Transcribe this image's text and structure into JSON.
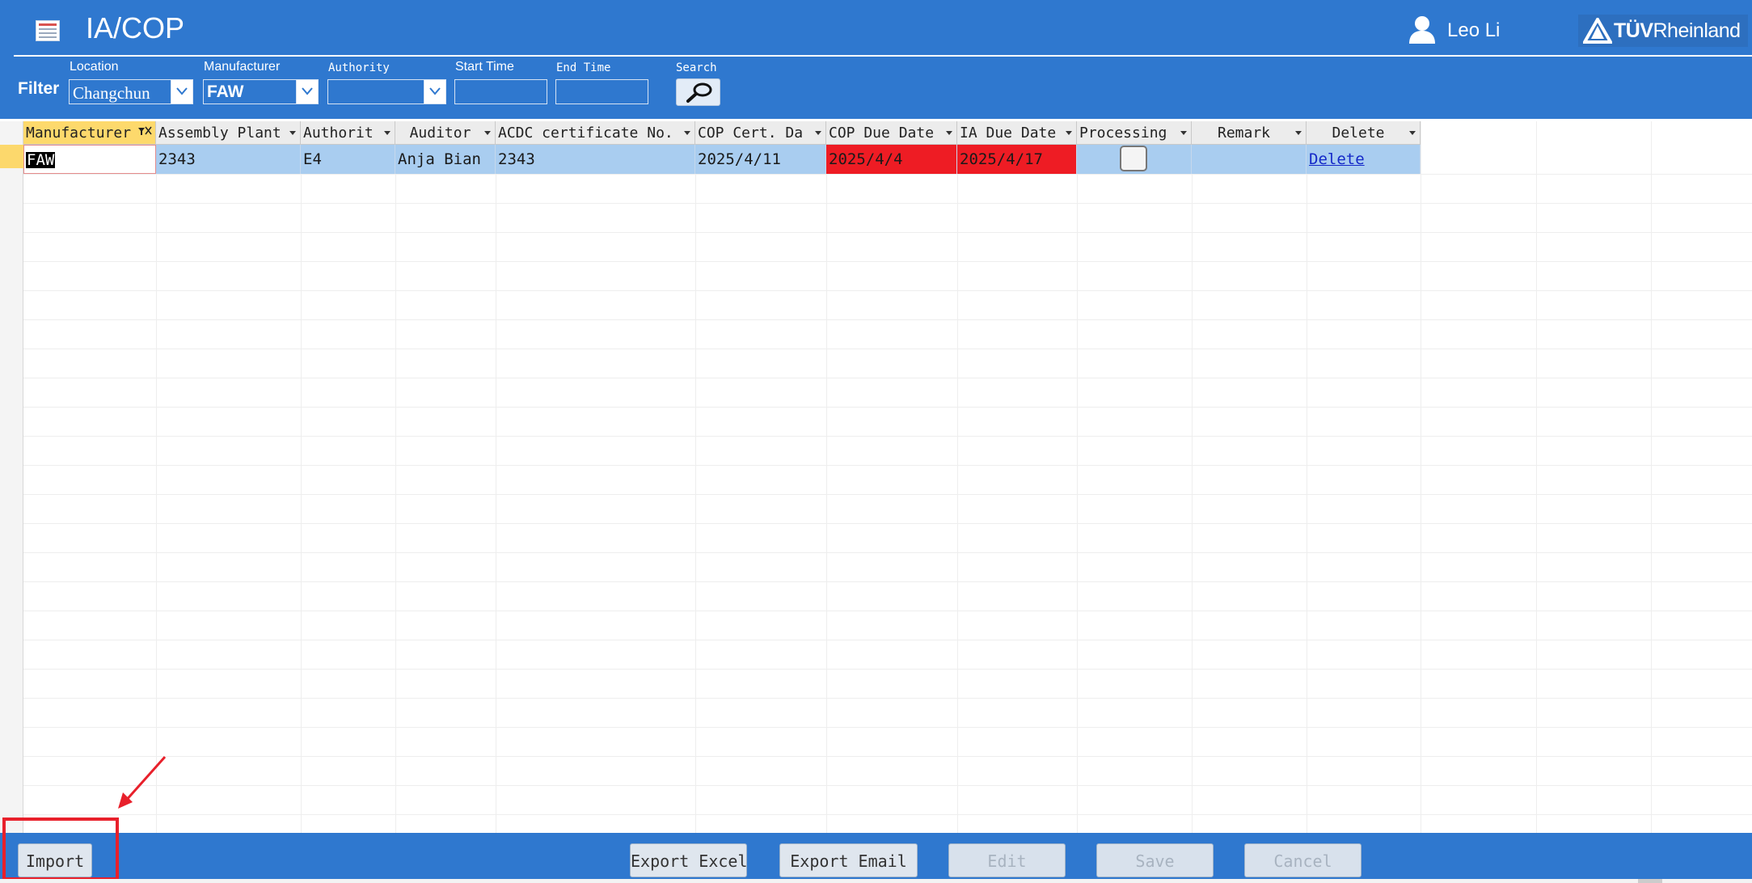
{
  "header": {
    "title": "IA/COP",
    "user_name": "Leo Li",
    "brand_bold": "TÜV",
    "brand_rest": "Rheinland",
    "accent_color": "#2f78cf"
  },
  "filter": {
    "label": "Filter",
    "location_label": "Location",
    "location_value": "Changchun",
    "manufacturer_label": "Manufacturer",
    "manufacturer_value": "FAW",
    "authority_label": "Authority",
    "authority_value": "",
    "start_time_label": "Start Time",
    "start_time_value": "",
    "end_time_label": "End Time",
    "end_time_value": "",
    "search_label": "Search"
  },
  "table": {
    "columns": [
      "Manufacturer",
      "Assembly Plant",
      "Authorit",
      "Auditor",
      "ACDC certificate No.",
      "COP Cert. Da",
      "COP Due Date",
      "IA Due Date",
      "Processing",
      "Remark",
      "Delete"
    ],
    "rows": [
      {
        "manufacturer": "FAW",
        "assembly_plant": "2343",
        "authority": "E4",
        "auditor": "Anja Bian",
        "acdc_cert_no": "2343",
        "cop_cert_date": "2025/4/11",
        "cop_due_date": "2025/4/4",
        "ia_due_date": "2025/4/17",
        "processing": false,
        "remark": "",
        "delete_link": "Delete"
      }
    ],
    "overdue_color": "#ee1c24"
  },
  "footer": {
    "import": "Import",
    "export_excel": "Export Excel",
    "export_email": "Export Email",
    "edit": "Edit",
    "save": "Save",
    "cancel": "Cancel"
  }
}
